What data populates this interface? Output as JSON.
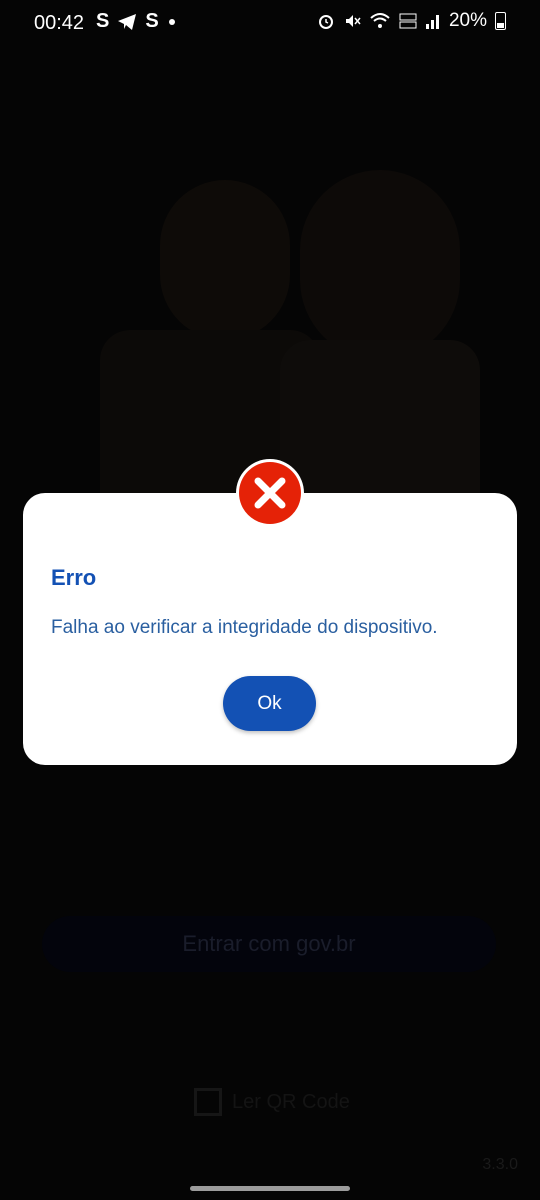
{
  "status_bar": {
    "time": "00:42",
    "left_icons": [
      "S",
      "S"
    ],
    "battery": "20%",
    "icons": [
      "telegram-icon",
      "dot-icon",
      "alarm-icon",
      "mute-icon",
      "wifi-icon",
      "volte-icon",
      "signal-icon",
      "battery-icon"
    ]
  },
  "background": {
    "primary_button": "Entrar com gov.br",
    "qr_label": "Ler QR Code",
    "version": "3.3.0"
  },
  "dialog": {
    "title": "Erro",
    "message": "Falha ao verificar a integridade do dispositivo.",
    "ok_label": "Ok",
    "error_color": "#e52207",
    "accent_color": "#1351b4"
  }
}
